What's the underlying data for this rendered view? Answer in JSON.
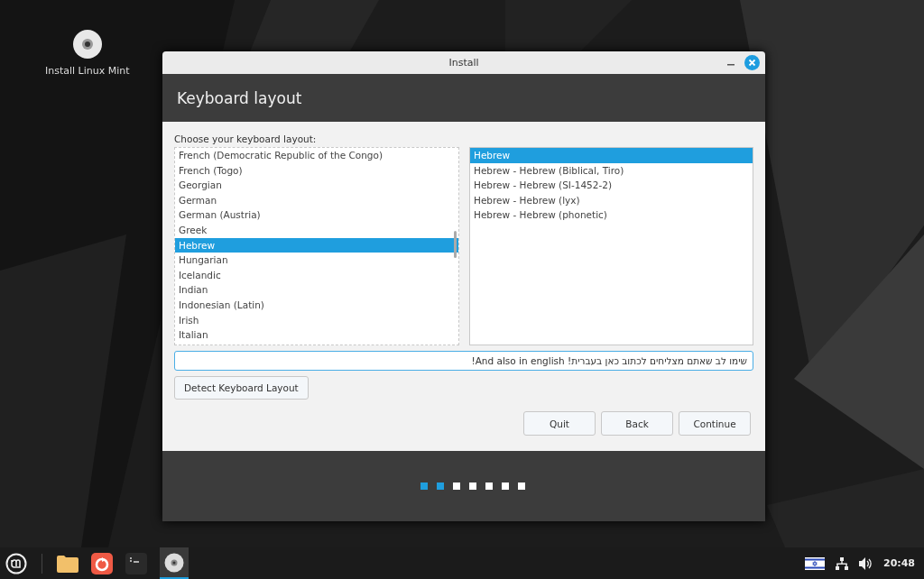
{
  "desktop_icons": [
    {
      "label": "Install Linux Mint"
    }
  ],
  "window": {
    "title": "Install",
    "heading": "Keyboard layout"
  },
  "layout_list": {
    "label": "Choose your keyboard layout:",
    "items": [
      {
        "label": "French (Democratic Republic of the Congo)",
        "selected": false
      },
      {
        "label": "French (Togo)",
        "selected": false
      },
      {
        "label": "Georgian",
        "selected": false
      },
      {
        "label": "German",
        "selected": false
      },
      {
        "label": "German (Austria)",
        "selected": false
      },
      {
        "label": "Greek",
        "selected": false
      },
      {
        "label": "Hebrew",
        "selected": true
      },
      {
        "label": "Hungarian",
        "selected": false
      },
      {
        "label": "Icelandic",
        "selected": false
      },
      {
        "label": "Indian",
        "selected": false
      },
      {
        "label": "Indonesian (Latin)",
        "selected": false
      },
      {
        "label": "Irish",
        "selected": false
      },
      {
        "label": "Italian",
        "selected": false
      }
    ]
  },
  "variant_list": {
    "items": [
      {
        "label": "Hebrew",
        "selected": true
      },
      {
        "label": "Hebrew - Hebrew (Biblical, Tiro)",
        "selected": false
      },
      {
        "label": "Hebrew - Hebrew (SI-1452-2)",
        "selected": false
      },
      {
        "label": "Hebrew - Hebrew (lyx)",
        "selected": false
      },
      {
        "label": "Hebrew - Hebrew (phonetic)",
        "selected": false
      }
    ]
  },
  "test_field": {
    "value": "שימו לב שאתם מצליחים לכתוב כאן בעברית! And also in english!"
  },
  "detect_button": "Detect Keyboard Layout",
  "buttons": [
    "Quit",
    "Back",
    "Continue"
  ],
  "steps": [
    {
      "done": true
    },
    {
      "done": true
    },
    {
      "done": false
    },
    {
      "done": false
    },
    {
      "done": false
    },
    {
      "done": false
    },
    {
      "done": false
    }
  ],
  "taskbar": {
    "clock": "20:48"
  }
}
